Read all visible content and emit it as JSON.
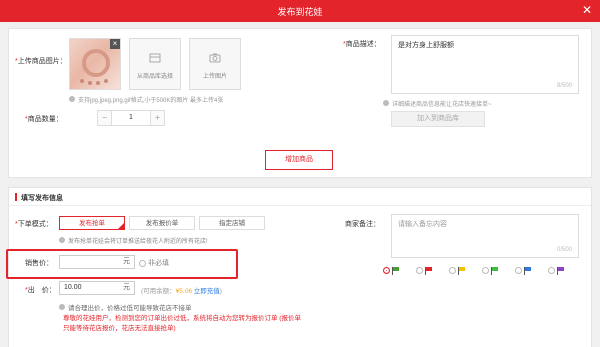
{
  "header": {
    "title": "发布到花娃",
    "close_label": "✕"
  },
  "product": {
    "image_label": "上传商品图片：",
    "library_button": "从商品库选择",
    "upload_button": "上传图片",
    "image_hint": "支持jpg,jpeg,png,gif格式,小于500K的图片 最多上传4张",
    "quantity_label": "商品数量：",
    "quantity_value": "1",
    "minus": "−",
    "plus": "+",
    "desc_label": "商品描述：",
    "desc_value": "是对方身上舒服额",
    "desc_count": "8/500",
    "desc_hint": "详细描述商品信息能让花店快速接单~",
    "add_to_library": "加入到商品库",
    "add_product_button": "增加商品"
  },
  "publish": {
    "section_title": "填写发布信息",
    "mode_label": "下单模式：",
    "modes": [
      "发布抢单",
      "发布报价单",
      "指定店铺"
    ],
    "mode_hint": "发布抢单花娃会将订单推送给夜花人附近的所有花店!",
    "price_label": "销售价：",
    "price_unit": "元",
    "price_optional": "非必填",
    "offer_label": "出　价：",
    "offer_value": "10.00",
    "offer_unit": "元",
    "balance_prefix": "(可用余额：",
    "balance_value": "¥5.06",
    "recharge_link": "立即充值",
    "balance_suffix": ")",
    "tip_line1": "请合理出价，价格过低可能导致花店不接单",
    "tip_line2": "尊敬的花娃用户，检测到您的订单出价过低，系统将自动为您转为报价订单 (报价单",
    "tip_line3": "只能等待花店报价，花店无法直接抢单)",
    "remark_label": "商家备注：",
    "remark_placeholder": "请输入备忘内容",
    "remark_count": "0/500",
    "flag_colors": [
      "#4a9e3a",
      "#e3242b",
      "#f2c200",
      "#3fbf3f",
      "#2a7ae2",
      "#8e44c9"
    ]
  }
}
